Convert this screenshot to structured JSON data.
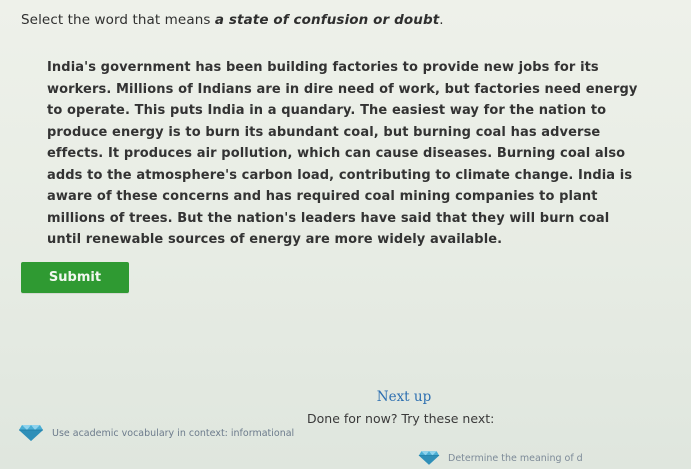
{
  "question": {
    "prefix": "Select the word that means ",
    "emphasis": "a state of confusion or doubt",
    "suffix": "."
  },
  "passage": {
    "text": "India's government has been building factories to provide new jobs for its workers. Millions of Indians are in dire need of work, but factories need energy to operate. This puts India in a quandary. The easiest way for the nation to produce energy is to burn its abundant coal, but burning coal has adverse effects. It produces air pollution, which can cause diseases. Burning coal also adds to the atmosphere's carbon load, contributing to climate change. India is aware of these concerns and has required coal mining companies to plant millions of trees. But the nation's leaders have said that they will burn coal until renewable sources of energy are more widely available."
  },
  "submit_label": "Submit",
  "next": {
    "heading": "Next up",
    "subheading": "Done for now? Try these next:",
    "items": [
      {
        "label": "Use academic vocabulary in context: informational",
        "icon": "diamond-icon"
      },
      {
        "label": "Determine the meaning of d",
        "icon": "diamond-icon"
      }
    ]
  },
  "colors": {
    "submit": "#2f9a32",
    "link": "#2d6fb0",
    "diamond": "#3aa0c8"
  }
}
